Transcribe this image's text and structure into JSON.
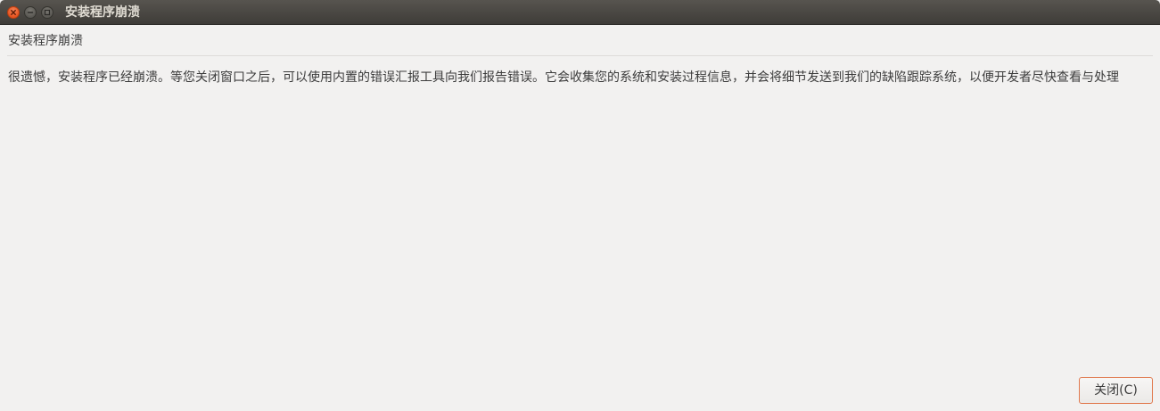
{
  "window": {
    "title": "安装程序崩溃",
    "controls": {
      "close": "close-icon",
      "minimize": "minimize-icon",
      "maximize": "maximize-icon"
    }
  },
  "dialog": {
    "header": "安装程序崩溃",
    "message": "很遗憾，安装程序已经崩溃。等您关闭窗口之后，可以使用内置的错误汇报工具向我们报告错误。它会收集您的系统和安装过程信息，并会将细节发送到我们的缺陷跟踪系统，以便开发者尽快查看与处理",
    "close_button_label": "关闭(C)"
  },
  "colors": {
    "titlebar": "#3e3c38",
    "close_accent": "#e5521e",
    "background": "#f2f1f0",
    "button_focus_border": "#e0784d"
  }
}
